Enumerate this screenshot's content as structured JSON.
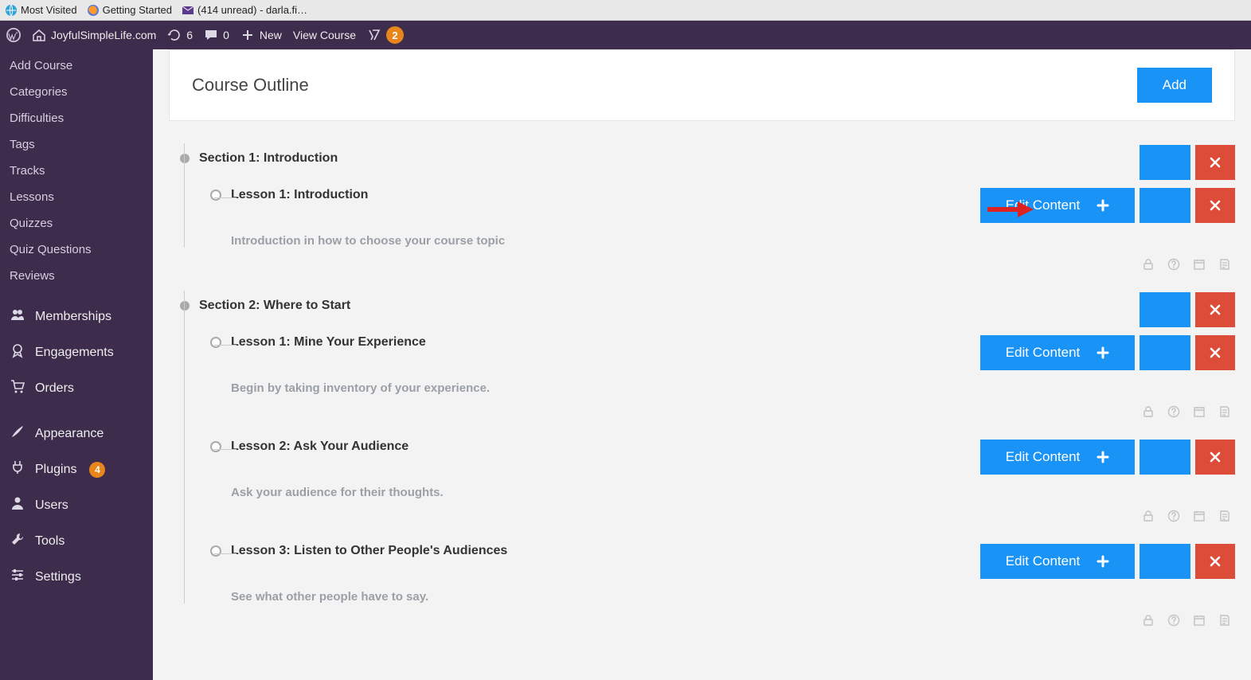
{
  "browser": {
    "bookmarks": [
      {
        "label": "Most Visited",
        "icon": "globe"
      },
      {
        "label": "Getting Started",
        "icon": "firefox"
      },
      {
        "label": "(414 unread) - darla.fi…",
        "icon": "mail"
      }
    ]
  },
  "adminbar": {
    "site_name": "JoyfulSimpleLife.com",
    "refresh_count": "6",
    "comments_count": "0",
    "new_label": "New",
    "view_course_label": "View Course",
    "yoast_badge": "2"
  },
  "sidebar": {
    "sub_items": [
      "Add Course",
      "Categories",
      "Difficulties",
      "Tags",
      "Tracks",
      "Lessons",
      "Quizzes",
      "Quiz Questions",
      "Reviews"
    ],
    "group1": [
      {
        "label": "Memberships",
        "icon": "users"
      },
      {
        "label": "Engagements",
        "icon": "medal"
      },
      {
        "label": "Orders",
        "icon": "cart"
      }
    ],
    "group2": [
      {
        "label": "Appearance",
        "icon": "brush"
      },
      {
        "label": "Plugins",
        "icon": "plug",
        "badge": "4"
      },
      {
        "label": "Users",
        "icon": "person"
      },
      {
        "label": "Tools",
        "icon": "wrench"
      },
      {
        "label": "Settings",
        "icon": "sliders"
      }
    ]
  },
  "panel": {
    "title": "Course Outline",
    "add_label": "Add"
  },
  "buttons": {
    "edit_content": "Edit Content"
  },
  "outline": {
    "sections": [
      {
        "title": "Section 1: Introduction",
        "lessons": [
          {
            "title": "Lesson 1: Introduction",
            "desc": "Introduction in how to choose your course topic",
            "highlight": true
          }
        ]
      },
      {
        "title": "Section 2: Where to Start",
        "lessons": [
          {
            "title": "Lesson 1: Mine Your Experience",
            "desc": "Begin by taking inventory of your experience."
          },
          {
            "title": "Lesson 2: Ask Your Audience",
            "desc": "Ask your audience for their thoughts."
          },
          {
            "title": "Lesson 3: Listen to Other People's Audiences",
            "desc": "See what other people have to say."
          }
        ]
      }
    ]
  }
}
